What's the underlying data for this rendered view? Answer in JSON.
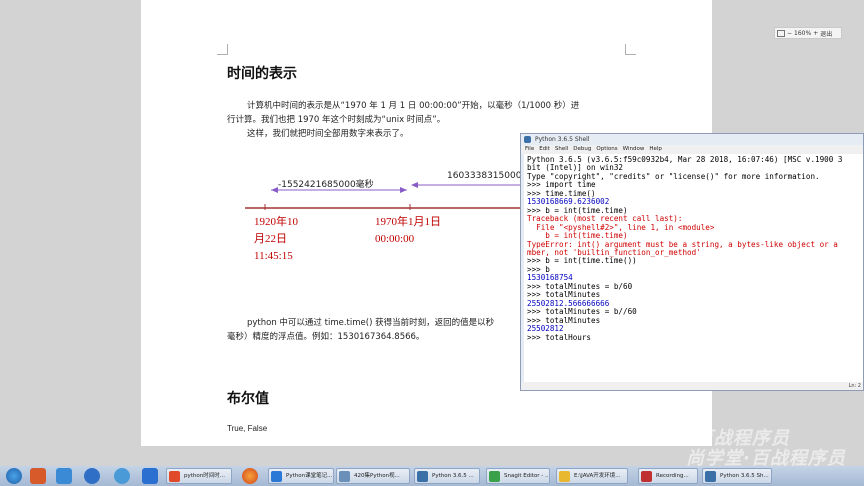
{
  "document": {
    "title": "时间的表示",
    "para1_line1": "计算机中时间的表示是从“1970 年 1 月 1 日 00:00:00”开始，以毫秒（1/1000 秒）进",
    "para1_line2": "行计算。我们也把 1970 年这个时刻成为“unix 时间点”。",
    "para2": "这样，我们就把时间全部用数字来表示了。",
    "timeline": {
      "left_arrow_label": "-1552421685000毫秒",
      "right_arrow_label": "1603338315000",
      "date_left_line1": "1920年10",
      "date_left_line2": "月22日",
      "date_left_line3": "11:45:15",
      "date_mid_line1": "1970年1月1日",
      "date_mid_line2": "00:00:00"
    },
    "para3_line1": "python 中可以通过 time.time() 获得当前时刻，返回的值是以秒",
    "para3_line2": "毫秒）精度的浮点值。例如：1530167364.8566。",
    "heading2": "布尔值",
    "bool_values": "True, False"
  },
  "zoom": {
    "minus": "−",
    "level": "160%",
    "plus": "+",
    "exit": "退出"
  },
  "shell": {
    "title": "Python 3.6.5 Shell",
    "menu": [
      "File",
      "Edit",
      "Shell",
      "Debug",
      "Options",
      "Window",
      "Help"
    ],
    "lines": [
      {
        "text": "Python 3.6.5 (v3.6.5:f59c0932b4, Mar 28 2018, 16:07:46) [MSC v.1900 3",
        "color": "#000000"
      },
      {
        "text": "bit (Intel)] on win32",
        "color": "#000000"
      },
      {
        "text": "Type \"copyright\", \"credits\" or \"license()\" for more information.",
        "color": "#000000"
      },
      {
        "text": ">>> import time",
        "color": "#000000"
      },
      {
        "text": ">>> time.time()",
        "color": "#000000"
      },
      {
        "text": "1530168669.6236002",
        "color": "#0000c0"
      },
      {
        "text": ">>> b = int(time.time)",
        "color": "#000000"
      },
      {
        "text": "Traceback (most recent call last):",
        "color": "#d00000"
      },
      {
        "text": "  File \"<pyshell#2>\", line 1, in <module>",
        "color": "#d00000"
      },
      {
        "text": "    b = int(time.time)",
        "color": "#d00000"
      },
      {
        "text": "TypeError: int() argument must be a string, a bytes-like object or a",
        "color": "#d00000"
      },
      {
        "text": "mber, not 'builtin_function_or_method'",
        "color": "#d00000"
      },
      {
        "text": ">>> b = int(time.time())",
        "color": "#000000"
      },
      {
        "text": ">>> b",
        "color": "#000000"
      },
      {
        "text": "1530168754",
        "color": "#0000c0"
      },
      {
        "text": ">>> totalMinutes = b/60",
        "color": "#000000"
      },
      {
        "text": ">>> totalMinutes",
        "color": "#000000"
      },
      {
        "text": "25502812.566666666",
        "color": "#0000c0"
      },
      {
        "text": ">>> totalMinutes = b//60",
        "color": "#000000"
      },
      {
        "text": ">>> totalMinutes",
        "color": "#000000"
      },
      {
        "text": "25502812",
        "color": "#0000c0"
      },
      {
        "text": ">>> totalHours",
        "color": "#000000"
      }
    ],
    "status": "Ln: 2"
  },
  "taskbar": {
    "buttons": [
      {
        "label": "python时间时...",
        "icon_color": "#e04a2a"
      },
      {
        "label": "Python课堂笔记...",
        "icon_color": "#2b79d6"
      },
      {
        "label": "420集Python视...",
        "icon_color": "#6a8fb8"
      },
      {
        "label": "Python 3.6.5 ...",
        "icon_color": "#3b6fa8"
      },
      {
        "label": "Snagit Editor - ...",
        "icon_color": "#3aa04a"
      },
      {
        "label": "E:\\JAVA开发环境...",
        "icon_color": "#e8b830"
      },
      {
        "label": "Recording...",
        "icon_color": "#c03030"
      },
      {
        "label": "Python 3.6.5 Sh...",
        "icon_color": "#3b6fa8"
      }
    ]
  },
  "watermark": {
    "line1": "尚学堂·百战程序员",
    "line2": "尚学堂·百战程序员"
  },
  "colors": {
    "accent_red": "#c00000",
    "arrow_purple": "#8a5cc7",
    "timeline_line": "#a33434"
  }
}
